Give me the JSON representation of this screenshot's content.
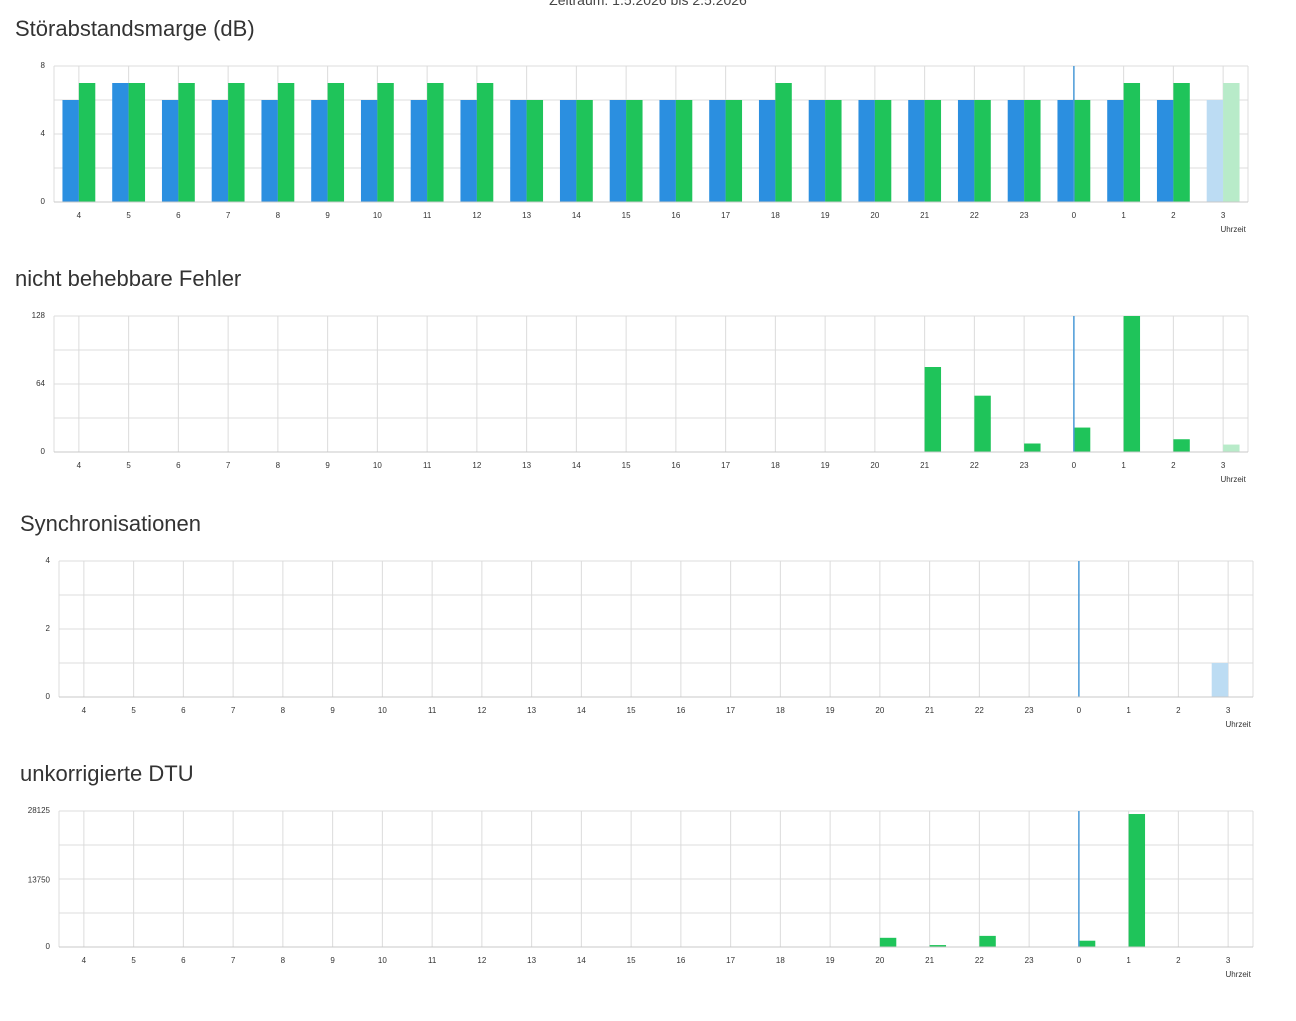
{
  "period_label": "Zeitraum: 1.5.2026 bis 2.5.2026",
  "colors": {
    "blue": "#2b8fe0",
    "green": "#1fc45a",
    "blue_faded": "#bcdcf3",
    "green_faded": "#b8ebc9",
    "grid": "#dcdcdc",
    "marker": "#4a9bd8"
  },
  "chart_data": [
    {
      "type": "bar",
      "title": "Störabstandsmarge (dB)",
      "xlabel": "Uhrzeit",
      "categories": [
        "4",
        "5",
        "6",
        "7",
        "8",
        "9",
        "10",
        "11",
        "12",
        "13",
        "14",
        "15",
        "16",
        "17",
        "18",
        "19",
        "20",
        "21",
        "22",
        "23",
        "0",
        "1",
        "2",
        "3"
      ],
      "yticks": [
        "0",
        "4",
        "8"
      ],
      "ylim": [
        0,
        8
      ],
      "marker_at": "0",
      "faded_last": true,
      "series": [
        {
          "color_key": "blue",
          "values": [
            6,
            7,
            6,
            6,
            6,
            6,
            6,
            6,
            6,
            6,
            6,
            6,
            6,
            6,
            6,
            6,
            6,
            6,
            6,
            6,
            6,
            6,
            6,
            6
          ]
        },
        {
          "color_key": "green",
          "values": [
            7,
            7,
            7,
            7,
            7,
            7,
            7,
            7,
            7,
            6,
            6,
            6,
            6,
            6,
            7,
            6,
            6,
            6,
            6,
            6,
            6,
            7,
            7,
            7
          ]
        }
      ]
    },
    {
      "type": "bar",
      "title": "nicht behebbare Fehler",
      "xlabel": "Uhrzeit",
      "categories": [
        "4",
        "5",
        "6",
        "7",
        "8",
        "9",
        "10",
        "11",
        "12",
        "13",
        "14",
        "15",
        "16",
        "17",
        "18",
        "19",
        "20",
        "21",
        "22",
        "23",
        "0",
        "1",
        "2",
        "3"
      ],
      "yticks": [
        "0",
        "64",
        "128"
      ],
      "ylim": [
        0,
        128
      ],
      "marker_at": "0",
      "faded_last": true,
      "series": [
        {
          "color_key": "blue",
          "values": [
            0,
            0,
            0,
            0,
            0,
            0,
            0,
            0,
            0,
            0,
            0,
            0,
            0,
            0,
            0,
            0,
            0,
            0,
            0,
            0,
            0,
            0,
            0,
            0
          ]
        },
        {
          "color_key": "green",
          "values": [
            0,
            0,
            0,
            0,
            0,
            0,
            0,
            0,
            0,
            0,
            0,
            0,
            0,
            0,
            0,
            0,
            0,
            80,
            53,
            8,
            23,
            128,
            12,
            7
          ]
        }
      ]
    },
    {
      "type": "bar",
      "title": "Synchronisationen",
      "xlabel": "Uhrzeit",
      "categories": [
        "4",
        "5",
        "6",
        "7",
        "8",
        "9",
        "10",
        "11",
        "12",
        "13",
        "14",
        "15",
        "16",
        "17",
        "18",
        "19",
        "20",
        "21",
        "22",
        "23",
        "0",
        "1",
        "2",
        "3"
      ],
      "yticks": [
        "0",
        "2",
        "4"
      ],
      "ylim": [
        0,
        4
      ],
      "marker_at": "0",
      "faded_last": true,
      "series": [
        {
          "color_key": "blue",
          "values": [
            0,
            0,
            0,
            0,
            0,
            0,
            0,
            0,
            0,
            0,
            0,
            0,
            0,
            0,
            0,
            0,
            0,
            0,
            0,
            0,
            0,
            0,
            0,
            1
          ]
        },
        {
          "color_key": "green",
          "values": [
            0,
            0,
            0,
            0,
            0,
            0,
            0,
            0,
            0,
            0,
            0,
            0,
            0,
            0,
            0,
            0,
            0,
            0,
            0,
            0,
            0,
            0,
            0,
            0
          ]
        }
      ]
    },
    {
      "type": "bar",
      "title": "unkorrigierte DTU",
      "xlabel": "Uhrzeit",
      "categories": [
        "4",
        "5",
        "6",
        "7",
        "8",
        "9",
        "10",
        "11",
        "12",
        "13",
        "14",
        "15",
        "16",
        "17",
        "18",
        "19",
        "20",
        "21",
        "22",
        "23",
        "0",
        "1",
        "2",
        "3"
      ],
      "yticks": [
        "0",
        "13750",
        "28125"
      ],
      "ylim": [
        0,
        28125
      ],
      "marker_at": "0",
      "faded_last": true,
      "series": [
        {
          "color_key": "blue",
          "values": [
            0,
            0,
            0,
            0,
            0,
            0,
            0,
            0,
            0,
            0,
            0,
            0,
            0,
            0,
            0,
            0,
            0,
            0,
            0,
            0,
            0,
            0,
            0,
            0
          ]
        },
        {
          "color_key": "green",
          "values": [
            0,
            0,
            0,
            0,
            0,
            0,
            0,
            0,
            0,
            0,
            0,
            0,
            0,
            0,
            0,
            0,
            1900,
            400,
            2300,
            0,
            1300,
            27500,
            0,
            0
          ]
        }
      ]
    }
  ]
}
